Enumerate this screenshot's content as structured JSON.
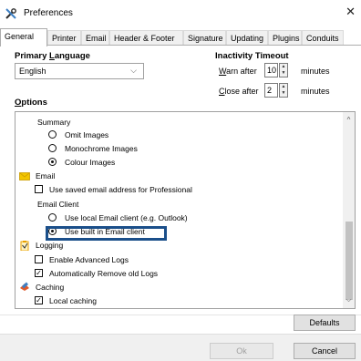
{
  "window": {
    "title": "Preferences",
    "close_glyph": "✕"
  },
  "tabs": [
    {
      "label": "General",
      "active": true
    },
    {
      "label": "Printer"
    },
    {
      "label": "Email"
    },
    {
      "label": "Header & Footer"
    },
    {
      "label": "Signature"
    },
    {
      "label": "Updating"
    },
    {
      "label": "Plugins"
    },
    {
      "label": "Conduits"
    }
  ],
  "primary_language": {
    "label_pre": "Primary ",
    "label_key": "L",
    "label_post": "anguage",
    "selected": "English",
    "chevron": "⌵"
  },
  "inactivity": {
    "title": "Inactivity Timeout",
    "warn_key": "W",
    "warn_rest": "arn after",
    "warn_value": "10",
    "close_key": "C",
    "close_rest": "lose after",
    "close_value": "2",
    "unit": "minutes"
  },
  "options": {
    "label_key": "O",
    "label_rest": "ptions",
    "summary_label": "Summary",
    "omit_images": "Omit Images",
    "monochrome_images": "Monochrome Images",
    "colour_images": "Colour Images",
    "email_label": "Email",
    "use_saved_email": "Use saved email address for Professional",
    "email_client_label": "Email Client",
    "use_local_client": "Use local Email client (e.g. Outlook)",
    "use_builtin_client": "Use built in Email client",
    "logging_label": "Logging",
    "enable_advanced_logs": "Enable Advanced Logs",
    "auto_remove_logs": "Automatically Remove old Logs",
    "caching_label": "Caching",
    "local_caching": "Local caching",
    "check_glyph": "✓",
    "scroll_up": "^",
    "scroll_down": "⌵"
  },
  "buttons": {
    "defaults": "Defaults",
    "ok": "Ok",
    "cancel": "Cancel"
  },
  "colors": {
    "highlight": "#1b4f8a",
    "email_icon": "#f2c500",
    "log_icon": "#e8a000",
    "cache_icon": "#c23b1f"
  }
}
